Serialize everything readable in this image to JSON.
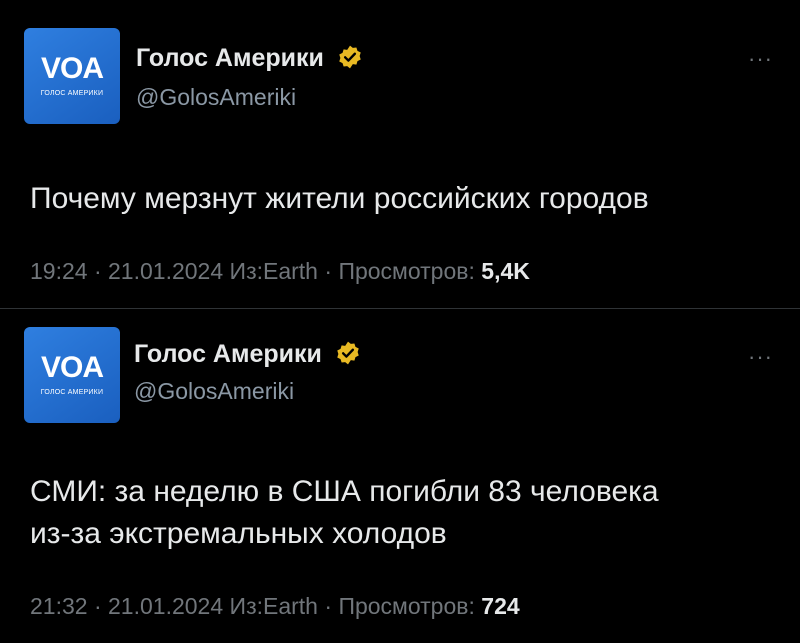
{
  "tweets": [
    {
      "avatar": {
        "logo": "VOA",
        "sub": "ГОЛОС АМЕРИКИ"
      },
      "author_name": "Голос Америки",
      "handle": "@GolosAmeriki",
      "more": "···",
      "text_lines": [
        "Почему мерзнут жители российских городов"
      ],
      "time": "19:24",
      "date": "21.01.2024",
      "source": "Из:Earth",
      "views_label": "Просмотров:",
      "views": "5,4K",
      "sep": "·"
    },
    {
      "avatar": {
        "logo": "VOA",
        "sub": "ГОЛОС АМЕРИКИ"
      },
      "author_name": "Голос Америки",
      "handle": "@GolosAmeriki",
      "more": "···",
      "text_lines": [
        "СМИ: за неделю в США погибли 83 человека",
        "из-за экстремальных холодов"
      ],
      "time": "21:32",
      "date": "21.01.2024",
      "source": "Из:Earth",
      "views_label": "Просмотров:",
      "views": "724",
      "sep": "·"
    }
  ],
  "colors": {
    "background": "#000000",
    "text": "#e7e9ea",
    "muted": "#71767b",
    "handle": "#8b98a5",
    "verified_badge": "#e8b923",
    "avatar_blue": "#1a5fbf"
  },
  "icons": {
    "verified": "verified-badge-icon",
    "more": "more-options-icon"
  }
}
